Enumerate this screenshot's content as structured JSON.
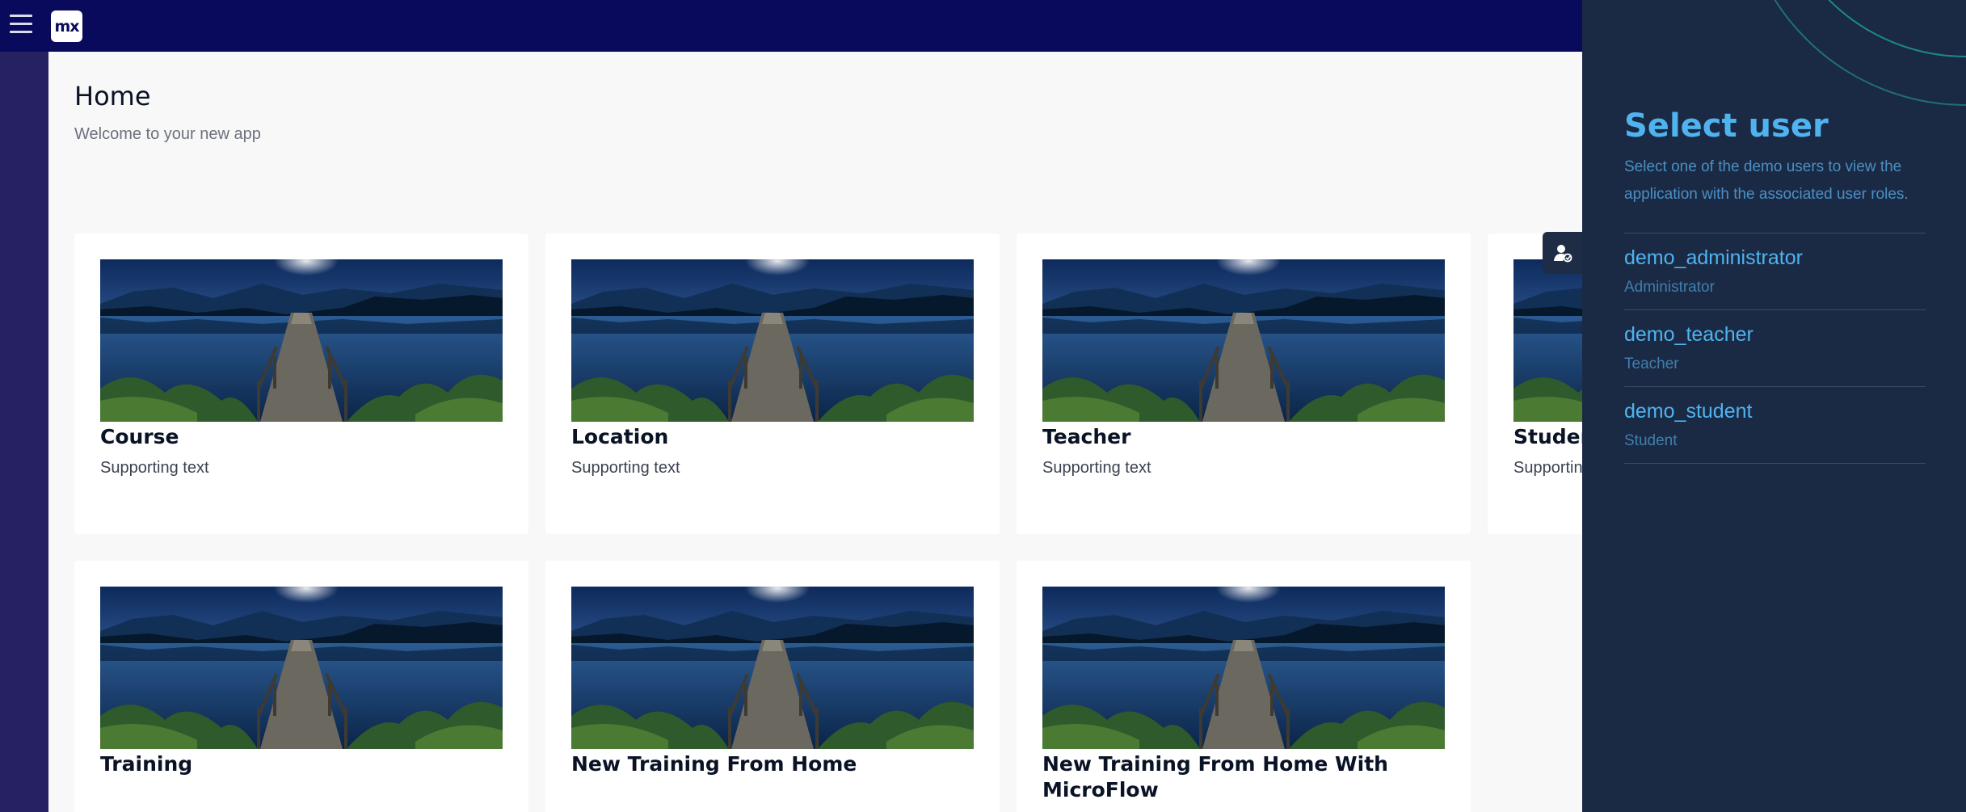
{
  "header": {
    "logo_text": "mx"
  },
  "page": {
    "title": "Home",
    "subtitle": "Welcome to your new app"
  },
  "cards": [
    {
      "title": "Course",
      "text": "Supporting text"
    },
    {
      "title": "Location",
      "text": "Supporting text"
    },
    {
      "title": "Teacher",
      "text": "Supporting text"
    },
    {
      "title": "Student",
      "text": "Supporting text"
    },
    {
      "title": "Training",
      "text": ""
    },
    {
      "title": "New Training From Home",
      "text": ""
    },
    {
      "title": "New Training From Home With MicroFlow",
      "text": ""
    }
  ],
  "user_panel": {
    "title": "Select user",
    "description": "Select one of the demo users to view the application with the associated user roles.",
    "users": [
      {
        "name": "demo_administrator",
        "role": "Administrator"
      },
      {
        "name": "demo_teacher",
        "role": "Teacher"
      },
      {
        "name": "demo_student",
        "role": "Student"
      }
    ]
  },
  "icons": {
    "menu": "hamburger-icon",
    "user_toggle": "user-switch-icon",
    "card_image": "lake-dock-image"
  },
  "colors": {
    "topbar": "#0a0a5c",
    "sidebar": "#262262",
    "panel": "#1b2a44",
    "accent": "#4fb3f0"
  }
}
